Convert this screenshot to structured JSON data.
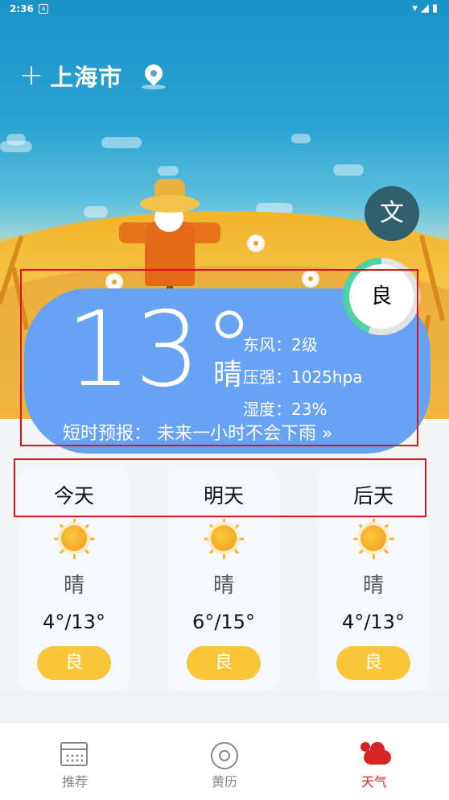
{
  "status_bar": {
    "time": "2:36",
    "notification_icon": "A"
  },
  "header": {
    "add_icon": "+",
    "city": "上海市",
    "location_icon": "location-pin"
  },
  "lang_button": {
    "label": "文"
  },
  "current": {
    "temperature": "13°",
    "condition": "晴",
    "wind": "东风：2级",
    "pressure": "压强：1025hpa",
    "humidity": "湿度：23%",
    "short_forecast": "短时预报： 未来一小时不会下雨 »",
    "aqi": "良"
  },
  "days": [
    {
      "label": "今天",
      "condition": "晴",
      "range": "4°/13°",
      "aqi": "良",
      "icon": "sun-icon"
    },
    {
      "label": "明天",
      "condition": "晴",
      "range": "6°/15°",
      "aqi": "良",
      "icon": "sun-icon"
    },
    {
      "label": "后天",
      "condition": "晴",
      "range": "4°/13°",
      "aqi": "良",
      "icon": "sun-icon"
    }
  ],
  "nav": [
    {
      "label": "推荐",
      "icon": "calendar-icon"
    },
    {
      "label": "黄历",
      "icon": "almanac-icon"
    },
    {
      "label": "天气",
      "icon": "weather-icon"
    }
  ],
  "colors": {
    "card": "#68a2f5",
    "accent": "#d62525",
    "aqi_pill": "#f9c639",
    "highlight": "#e0111b"
  }
}
